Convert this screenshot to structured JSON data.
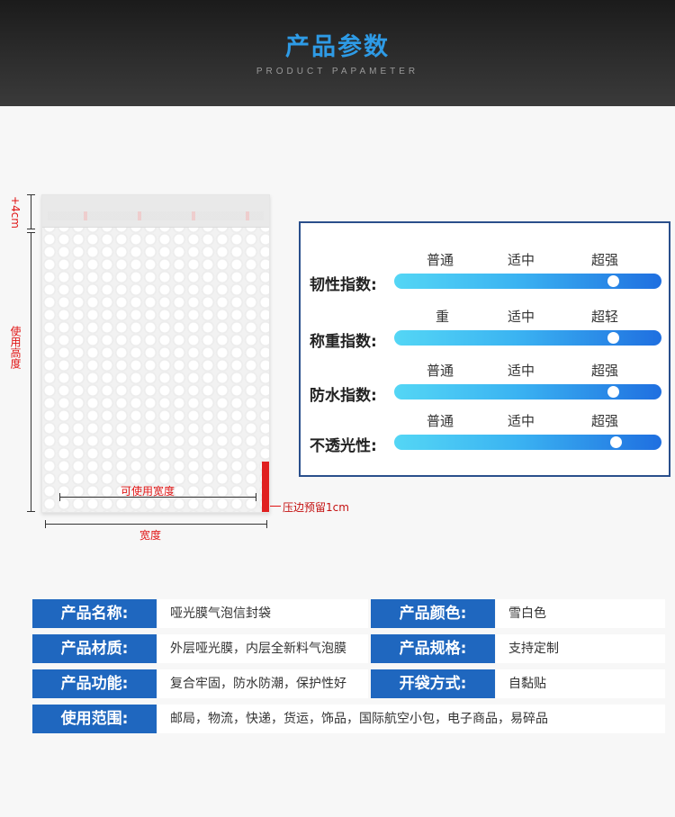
{
  "header": {
    "title": "产品参数",
    "subtitle": "PRODUCT PAPAMETER"
  },
  "diagram": {
    "flap_label": "+4cm",
    "height_label": "使用高度",
    "usable_width_label": "可使用宽度",
    "seal_label": "压边预留1cm",
    "width_label": "宽度"
  },
  "indices": [
    {
      "label": "韧性指数:",
      "levels": [
        "普通",
        "适中",
        "超强"
      ],
      "value": 0.82
    },
    {
      "label": "称重指数:",
      "levels": [
        "重",
        "适中",
        "超轻"
      ],
      "value": 0.82
    },
    {
      "label": "防水指数:",
      "levels": [
        "普通",
        "适中",
        "超强"
      ],
      "value": 0.82
    },
    {
      "label": "不透光性:",
      "levels": [
        "普通",
        "适中",
        "超强"
      ],
      "value": 0.83
    }
  ],
  "specs": {
    "name_label": "产品名称:",
    "name_value": "哑光膜气泡信封袋",
    "color_label": "产品颜色:",
    "color_value": "雪白色",
    "material_label": "产品材质:",
    "material_value": "外层哑光膜，内层全新料气泡膜",
    "size_label": "产品规格:",
    "size_value": "支持定制",
    "function_label": "产品功能:",
    "function_value": "复合牢固，防水防潮，保护性好",
    "opening_label": "开袋方式:",
    "opening_value": "自黏贴",
    "usage_label": "使用范围:",
    "usage_value": "邮局，物流，快递，货运，饰品，国际航空小包，电子商品，易碎品"
  },
  "colors": {
    "accent": "#1f67bf",
    "title": "#2e9be6",
    "mark": "#e01414"
  }
}
